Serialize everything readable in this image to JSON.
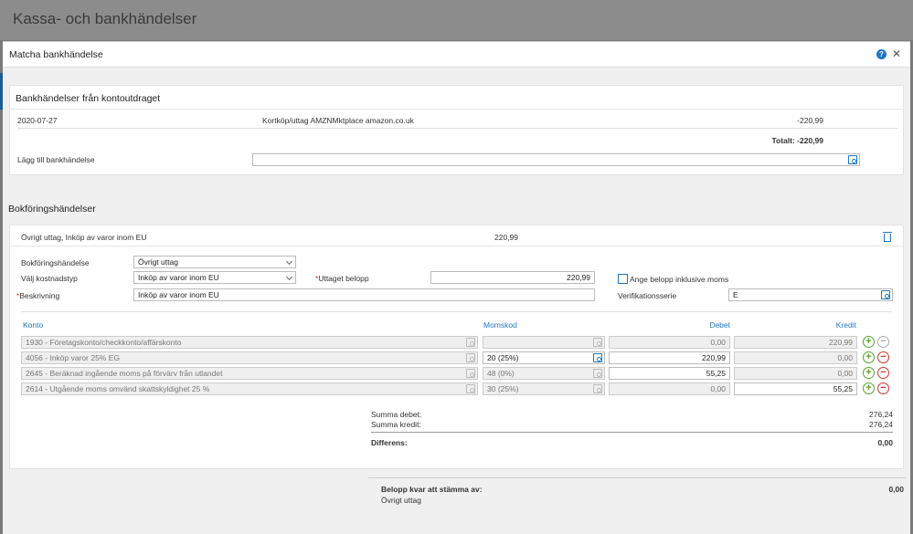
{
  "background": {
    "title": "Kassa- och bankhändelser"
  },
  "modal": {
    "title": "Matcha bankhändelse"
  },
  "bank": {
    "heading": "Bankhändelser från kontoutdraget",
    "event": {
      "date": "2020-07-27",
      "description": "Kortköp/uttag AMZNMktplace amazon.co.uk",
      "amount": "-220,99"
    },
    "total": "Totalt: -220,99",
    "add_label": "Lägg till bankhändelse",
    "add_value": ""
  },
  "booking": {
    "heading": "Bokföringshändelser",
    "summary": {
      "label": "Övrigt uttag, Inköp av varor inom EU",
      "amount": "220,99"
    },
    "form": {
      "event_label": "Bokföringshändelse",
      "event_value": "Övrigt uttag",
      "cost_label": "Välj kostnadstyp",
      "cost_value": "Inköp av varor inom EU",
      "withdrawn_label": "Uttaget belopp",
      "withdrawn_value": "220,99",
      "incl_vat_label": "Ange belopp inklusive moms",
      "desc_label": "Beskrivning",
      "desc_value": "Inköp av varor inom EU",
      "series_label": "Verifikationsserie",
      "series_value": "E"
    },
    "table": {
      "headers": {
        "konto": "Konto",
        "momskod": "Momskod",
        "debet": "Debet",
        "kredit": "Kredit"
      },
      "rows": [
        {
          "konto": "1930 - Företagskonto/checkkonto/affärskonto",
          "momskod": "",
          "debet": "0,00",
          "kredit": "220,99"
        },
        {
          "konto": "4056 - Inköp varor 25% EG",
          "momskod": "20 (25%)",
          "debet": "220,99",
          "kredit": "0,00"
        },
        {
          "konto": "2645 - Beräknad ingående moms på förvärv från utlandet",
          "momskod": "48 (0%)",
          "debet": "55,25",
          "kredit": "0,00"
        },
        {
          "konto": "2614 - Utgående moms omvänd skattskyldighet 25 %",
          "momskod": "30 (25%)",
          "debet": "0,00",
          "kredit": "55,25"
        }
      ]
    },
    "sums": {
      "debet_label": "Summa debet:",
      "debet_value": "276,24",
      "kredit_label": "Summa kredit:",
      "kredit_value": "276,24",
      "diff_label": "Differens:",
      "diff_value": "0,00"
    }
  },
  "footer": {
    "remaining_label": "Belopp kvar att stämma av:",
    "remaining_value": "0,00",
    "type": "Övrigt uttag"
  },
  "icons": {
    "help": "help-icon",
    "close": "close-icon",
    "lookup": "search-lookup-icon",
    "trash": "trash-icon",
    "add": "plus-circle-icon",
    "remove": "minus-circle-icon"
  },
  "colors": {
    "accent": "#1d77c7",
    "add": "#5aa02c",
    "remove": "#d0342c"
  }
}
